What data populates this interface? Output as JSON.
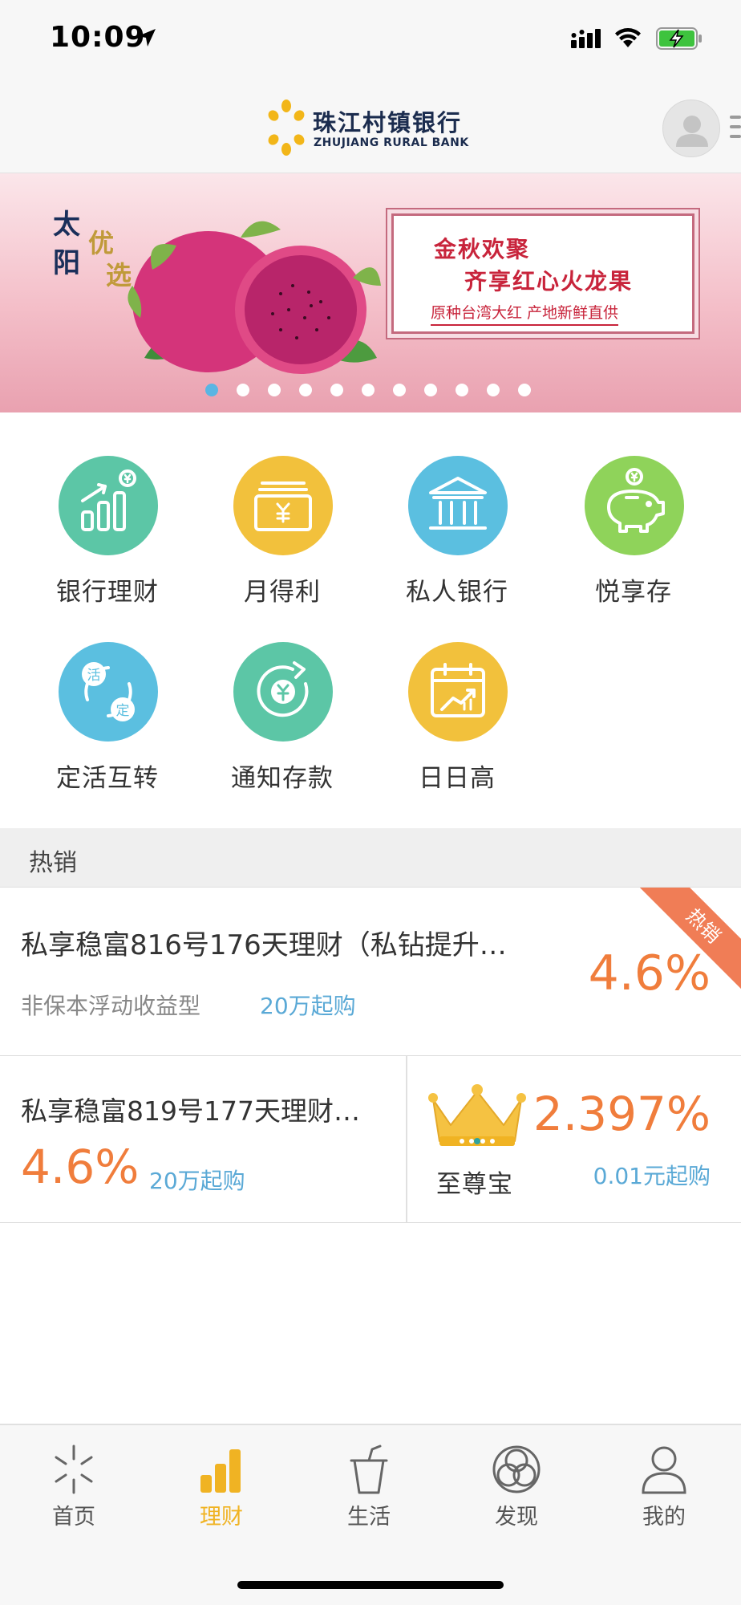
{
  "status_bar": {
    "time": "10:09"
  },
  "header": {
    "bank_name_cn": "珠江村镇银行",
    "bank_name_en": "ZHUJIANG RURAL BANK"
  },
  "banner": {
    "title_chars": [
      "太",
      "阳",
      "优",
      "选"
    ],
    "card_line1": "金秋欢聚",
    "card_line2": "齐享红心火龙果",
    "card_line3": "原种台湾大红  产地新鲜直供",
    "slide_count": 11,
    "active_slide": 1
  },
  "grid": {
    "items": [
      {
        "label": "银行理财",
        "icon": "wealth-chart-icon",
        "color": "#5cc6a6"
      },
      {
        "label": "月得利",
        "icon": "wallet-yuan-icon",
        "color": "#f2c13c"
      },
      {
        "label": "私人银行",
        "icon": "bank-building-icon",
        "color": "#5bbfe0"
      },
      {
        "label": "悦享存",
        "icon": "piggy-bank-icon",
        "color": "#8fd35a"
      },
      {
        "label": "定活互转",
        "icon": "exchange-circle-icon",
        "color": "#5bbfe0"
      },
      {
        "label": "通知存款",
        "icon": "coin-cycle-icon",
        "color": "#5cc6a6"
      },
      {
        "label": "日日高",
        "icon": "calendar-growth-icon",
        "color": "#f2c13c"
      }
    ]
  },
  "hot": {
    "section_title": "热销",
    "ribbon": "热销",
    "product1": {
      "name": "私享稳富816号176天理财（私钻提升…",
      "type": "非保本浮动收益型",
      "min_purchase": "20万起购",
      "rate": "4.6%"
    },
    "product2": {
      "name": "私享稳富819号177天理财…",
      "rate": "4.6%",
      "min_purchase": "20万起购"
    },
    "product3": {
      "name": "至尊宝",
      "rate": "2.397%",
      "min_purchase": "0.01元起购"
    }
  },
  "tabbar": {
    "tabs": [
      {
        "label": "首页",
        "icon": "home-sparkle-icon"
      },
      {
        "label": "理财",
        "icon": "bar-chart-icon",
        "active": true
      },
      {
        "label": "生活",
        "icon": "cup-icon"
      },
      {
        "label": "发现",
        "icon": "discover-rings-icon"
      },
      {
        "label": "我的",
        "icon": "person-icon"
      }
    ]
  },
  "colors": {
    "accent_orange": "#f07d3c",
    "link_blue": "#5aa9d6",
    "tab_active": "#f0b323"
  }
}
